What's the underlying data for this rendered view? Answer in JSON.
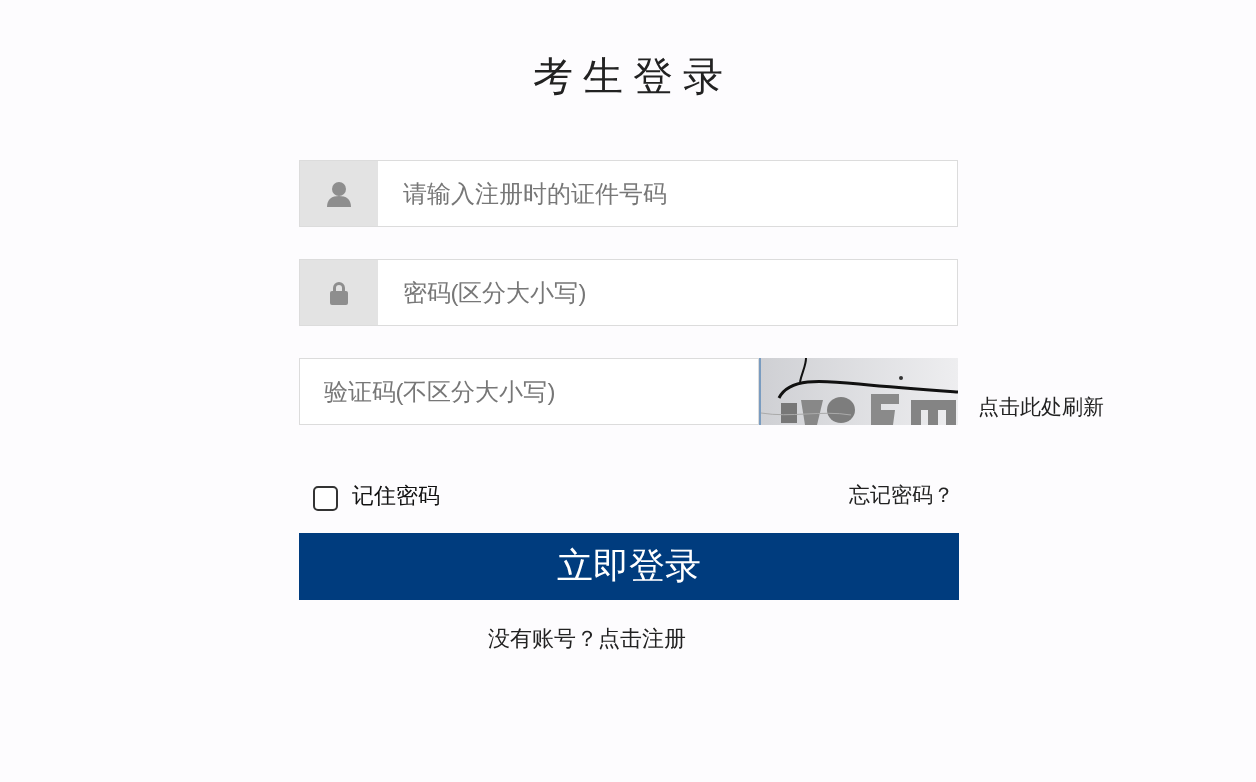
{
  "title": "考生登录",
  "fields": [
    {
      "kind": "user",
      "placeholder": "请输入注册时的证件号码"
    },
    {
      "kind": "lock",
      "placeholder": "密码(区分大小写)"
    },
    {
      "kind": "captcha",
      "placeholder": "验证码(不区分大小写)",
      "refresh_link": "点击此处刷新"
    }
  ],
  "remember": {
    "label": "记住密码",
    "checked": false
  },
  "forgot_link": "忘记密码？",
  "login_button": "立即登录",
  "register_link": "没有账号？点击注册"
}
